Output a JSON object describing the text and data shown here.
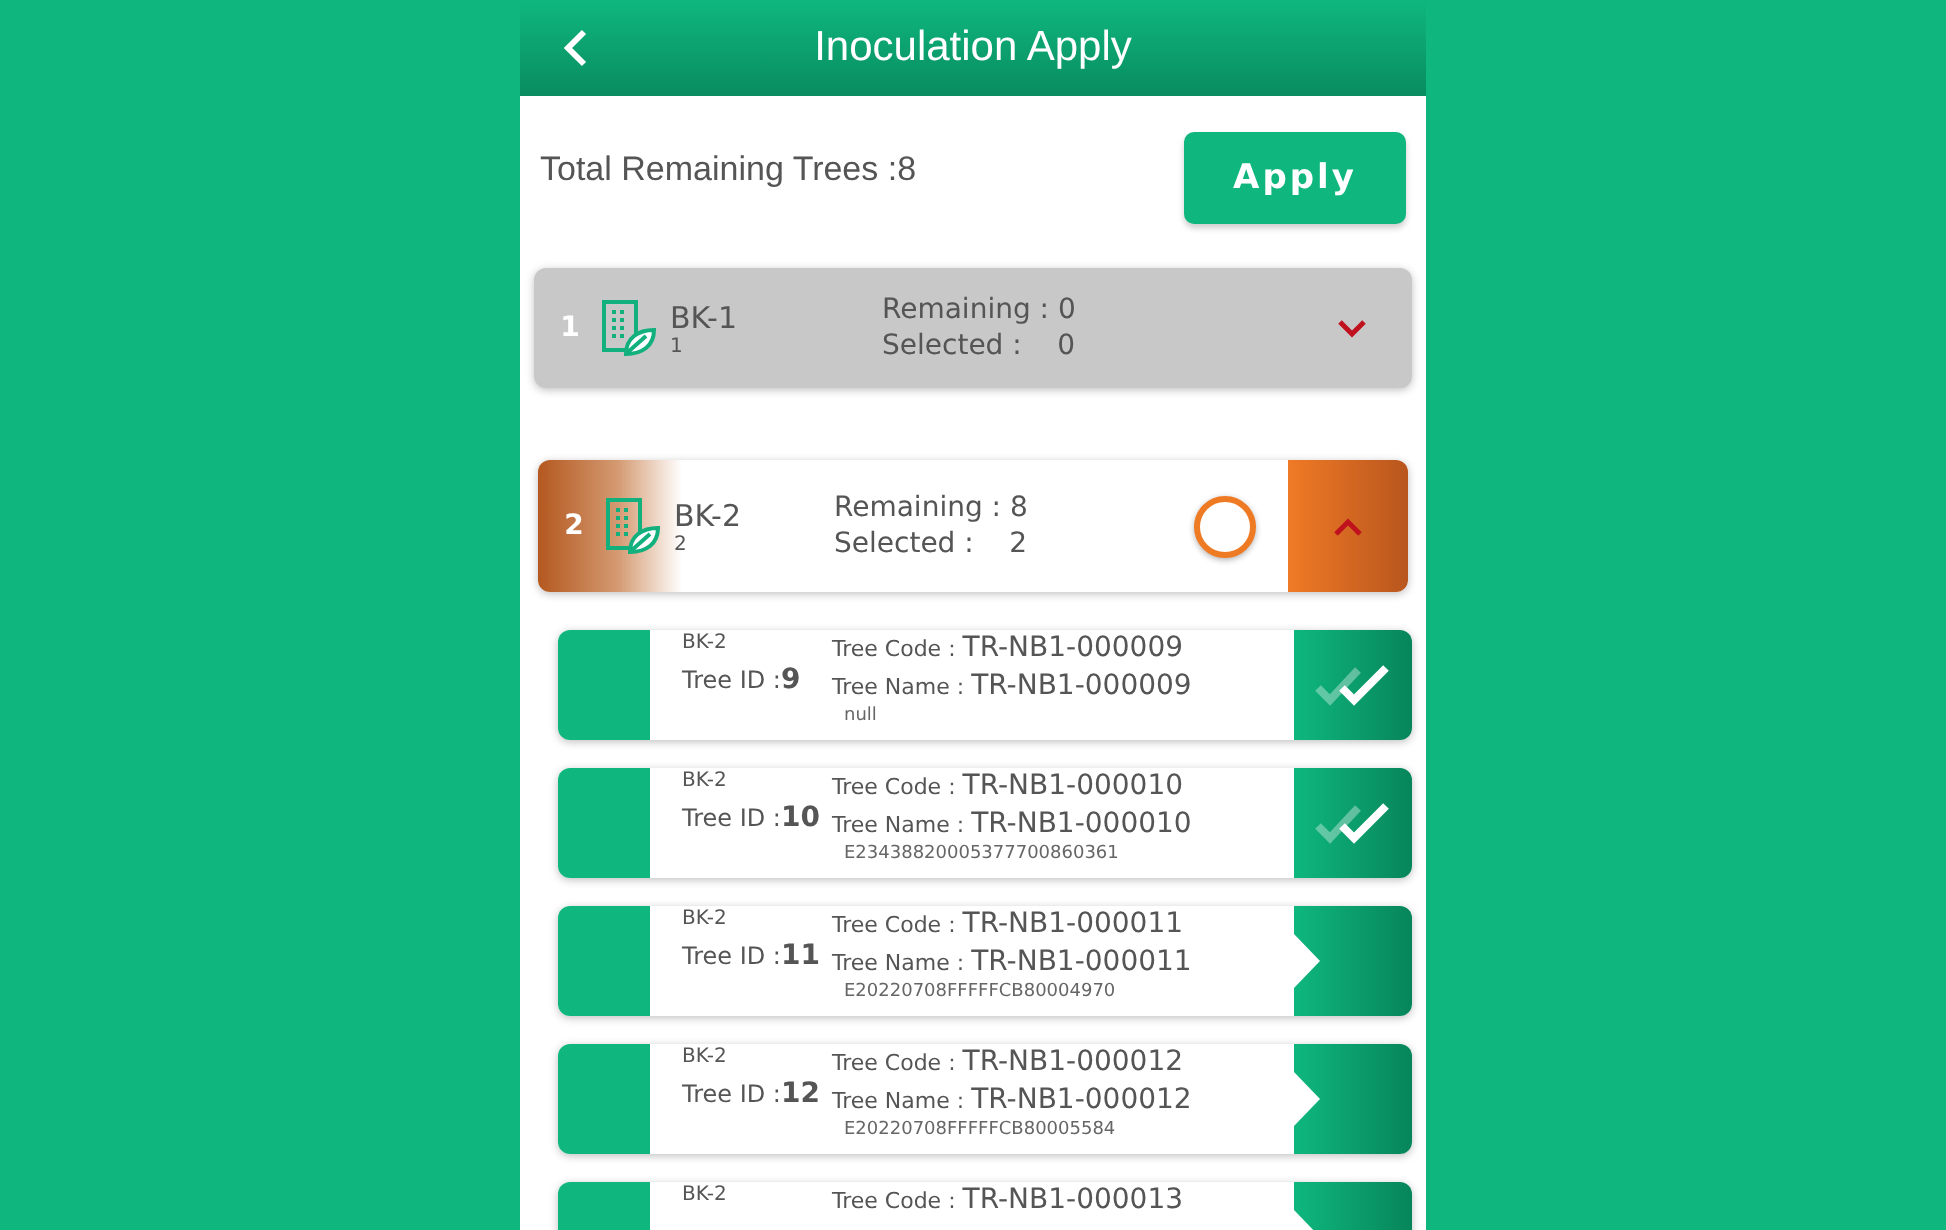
{
  "header": {
    "title": "Inoculation Apply"
  },
  "summary": {
    "label": "Total Remaining Trees :8",
    "apply_button": "Apply"
  },
  "blocks": [
    {
      "index": "1",
      "name": "BK-1",
      "sub": "1",
      "remaining": "Remaining : 0",
      "selected_label": "Selected :",
      "selected_value": "0",
      "expanded": false
    },
    {
      "index": "2",
      "name": "BK-2",
      "sub": "2",
      "remaining": "Remaining : 8",
      "selected_label": "Selected :",
      "selected_value": "2",
      "expanded": true,
      "checked": false,
      "trees": [
        {
          "block": "BK-2",
          "id_label": "Tree ID :",
          "id": "9",
          "code_label": "Tree Code :",
          "code": "TR-NB1-000009",
          "name_label": "Tree Name :",
          "name": "TR-NB1-000009",
          "tag": "null",
          "selected": true
        },
        {
          "block": "BK-2",
          "id_label": "Tree ID :",
          "id": "10",
          "code_label": "Tree Code :",
          "code": "TR-NB1-000010",
          "name_label": "Tree Name :",
          "name": "TR-NB1-000010",
          "tag": "E23438820005377700860361",
          "selected": true
        },
        {
          "block": "BK-2",
          "id_label": "Tree ID :",
          "id": "11",
          "code_label": "Tree Code :",
          "code": "TR-NB1-000011",
          "name_label": "Tree Name :",
          "name": "TR-NB1-000011",
          "tag": "E20220708FFFFFCB80004970",
          "selected": false
        },
        {
          "block": "BK-2",
          "id_label": "Tree ID :",
          "id": "12",
          "code_label": "Tree Code :",
          "code": "TR-NB1-000012",
          "name_label": "Tree Name :",
          "name": "TR-NB1-000012",
          "tag": "E20220708FFFFFCB80005584",
          "selected": false
        },
        {
          "block": "BK-2",
          "code_label": "Tree Code :",
          "code": "TR-NB1-000013",
          "selected": false
        }
      ]
    }
  ]
}
